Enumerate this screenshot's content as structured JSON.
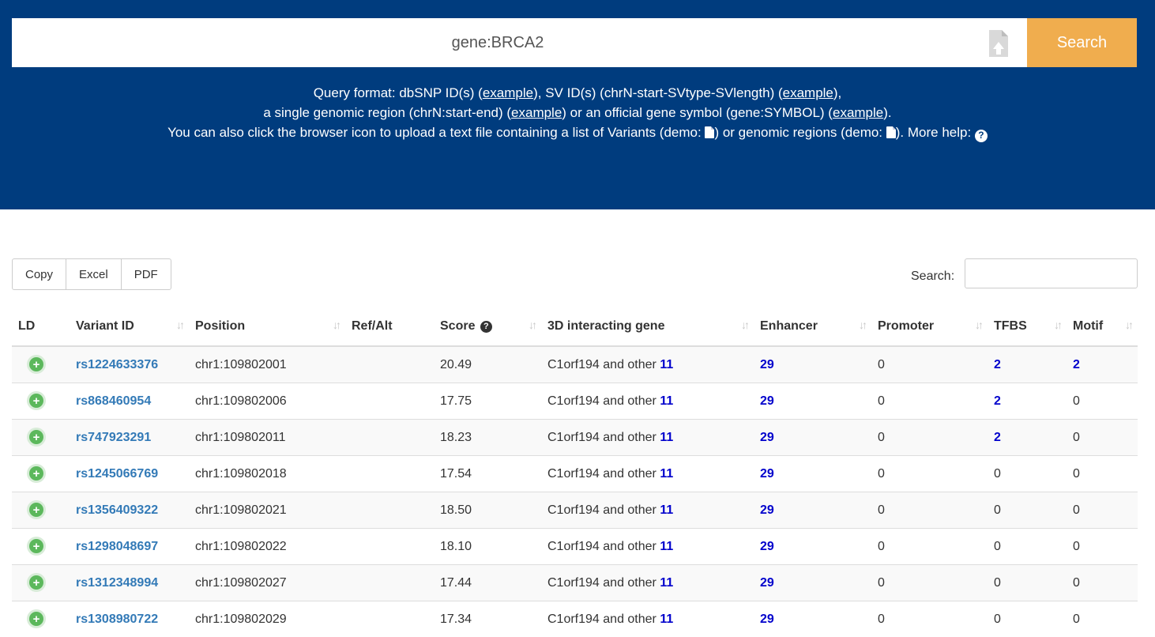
{
  "search": {
    "value": "gene:BRCA2",
    "button_label": "Search"
  },
  "help": {
    "line1_a": "Query format: dbSNP ID(s) (",
    "line1_link1": "example",
    "line1_b": "), SV ID(s) (chrN-start-SVtype-SVlength) (",
    "line1_link2": "example",
    "line1_c": "),",
    "line2_a": "a single genomic region (chrN:start-end) (",
    "line2_link1": "example",
    "line2_b": ") or an official gene symbol (gene:SYMBOL) (",
    "line2_link2": "example",
    "line2_c": ").",
    "line3_a": "You can also click the browser icon to upload a text file containing a list of Variants (demo: ",
    "line3_b": ") or genomic regions (demo: ",
    "line3_c": "). More help: "
  },
  "toolbar": {
    "copy": "Copy",
    "excel": "Excel",
    "pdf": "PDF",
    "search_label": "Search:"
  },
  "table": {
    "headers": [
      "LD",
      "Variant ID",
      "Position",
      "Ref/Alt",
      "Score",
      "3D interacting gene",
      "Enhancer",
      "Promoter",
      "TFBS",
      "Motif"
    ],
    "gene_prefix": "C1orf194 and other",
    "rows": [
      {
        "id": "rs1224633376",
        "pos": "chr1:109802001",
        "refalt": "",
        "score": "20.49",
        "others": "11",
        "enhancer": "29",
        "promoter": "0",
        "tfbs": "2",
        "motif": "2"
      },
      {
        "id": "rs868460954",
        "pos": "chr1:109802006",
        "refalt": "",
        "score": "17.75",
        "others": "11",
        "enhancer": "29",
        "promoter": "0",
        "tfbs": "2",
        "motif": "0"
      },
      {
        "id": "rs747923291",
        "pos": "chr1:109802011",
        "refalt": "",
        "score": "18.23",
        "others": "11",
        "enhancer": "29",
        "promoter": "0",
        "tfbs": "2",
        "motif": "0"
      },
      {
        "id": "rs1245066769",
        "pos": "chr1:109802018",
        "refalt": "",
        "score": "17.54",
        "others": "11",
        "enhancer": "29",
        "promoter": "0",
        "tfbs": "0",
        "motif": "0"
      },
      {
        "id": "rs1356409322",
        "pos": "chr1:109802021",
        "refalt": "",
        "score": "18.50",
        "others": "11",
        "enhancer": "29",
        "promoter": "0",
        "tfbs": "0",
        "motif": "0"
      },
      {
        "id": "rs1298048697",
        "pos": "chr1:109802022",
        "refalt": "",
        "score": "18.10",
        "others": "11",
        "enhancer": "29",
        "promoter": "0",
        "tfbs": "0",
        "motif": "0"
      },
      {
        "id": "rs1312348994",
        "pos": "chr1:109802027",
        "refalt": "",
        "score": "17.44",
        "others": "11",
        "enhancer": "29",
        "promoter": "0",
        "tfbs": "0",
        "motif": "0"
      },
      {
        "id": "rs1308980722",
        "pos": "chr1:109802029",
        "refalt": "",
        "score": "17.34",
        "others": "11",
        "enhancer": "29",
        "promoter": "0",
        "tfbs": "0",
        "motif": "0"
      }
    ]
  },
  "colors": {
    "banner": "#003c7e",
    "search_button": "#f0ad4e",
    "variant_link": "#337ab7",
    "count_link": "#0000cc",
    "ld_button": "#5cb85c"
  }
}
